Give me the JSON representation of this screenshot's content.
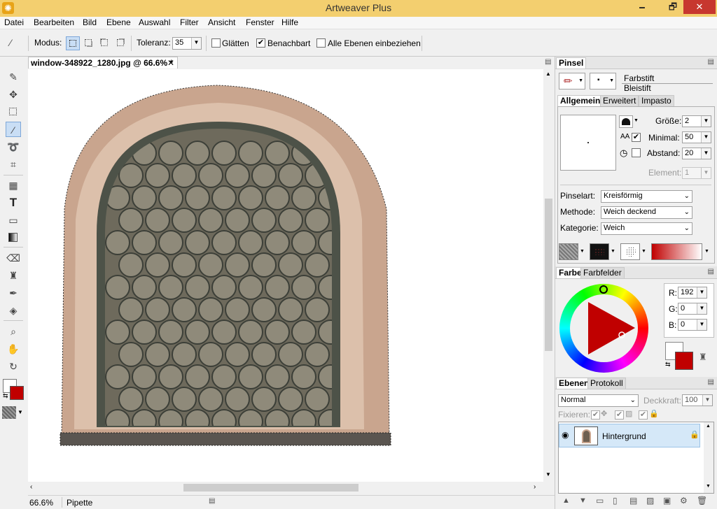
{
  "window": {
    "title": "Artweaver Plus",
    "minimize": "🗕",
    "restore": "🗗",
    "close": "✕"
  },
  "menu": [
    "Datei",
    "Bearbeiten",
    "Bild",
    "Ebene",
    "Auswahl",
    "Filter",
    "Ansicht",
    "Fenster",
    "Hilfe"
  ],
  "options": {
    "modus_label": "Modus:",
    "toleranz_label": "Toleranz:",
    "toleranz_value": "35",
    "glaetten_label": "Glätten",
    "glaetten_checked": false,
    "benachbart_label": "Benachbart",
    "benachbart_checked": true,
    "alle_ebenen_label": "Alle Ebenen einbeziehen",
    "alle_ebenen_checked": false
  },
  "document": {
    "tab_title": "window-348922_1280.jpg @ 66.6% *",
    "close": "✕"
  },
  "status": {
    "zoom": "66.6%",
    "tool": "Pipette"
  },
  "pinsel": {
    "panel_title": "Pinsel",
    "brush_category": "Farbstift",
    "brush_name": "Bleistift",
    "tabs": [
      "Allgemein",
      "Erweitert",
      "Impasto"
    ],
    "groesse_label": "Größe:",
    "groesse_value": "2",
    "minimal_label": "Minimal:",
    "minimal_value": "50",
    "abstand_label": "Abstand:",
    "abstand_value": "20",
    "element_label": "Element:",
    "element_value": "1",
    "pinselart_label": "Pinselart:",
    "pinselart_value": "Kreisförmig",
    "methode_label": "Methode:",
    "methode_value": "Weich deckend",
    "kategorie_label": "Kategorie:",
    "kategorie_value": "Weich",
    "minimal_checked": true,
    "abstand_checked": false
  },
  "farbe": {
    "tabs": [
      "Farbe",
      "Farbfelder"
    ],
    "r_label": "R:",
    "r_value": "192",
    "g_label": "G:",
    "g_value": "0",
    "b_label": "B:",
    "b_value": "0",
    "foreground": "#c00000",
    "background": "#ffffff"
  },
  "ebenen": {
    "tabs": [
      "Ebenen",
      "Protokoll"
    ],
    "blend_mode": "Normal",
    "deckkraft_label": "Deckkraft:",
    "deckkraft_value": "100",
    "fixieren_label": "Fixieren:",
    "layers": [
      {
        "name": "Hintergrund"
      }
    ]
  }
}
